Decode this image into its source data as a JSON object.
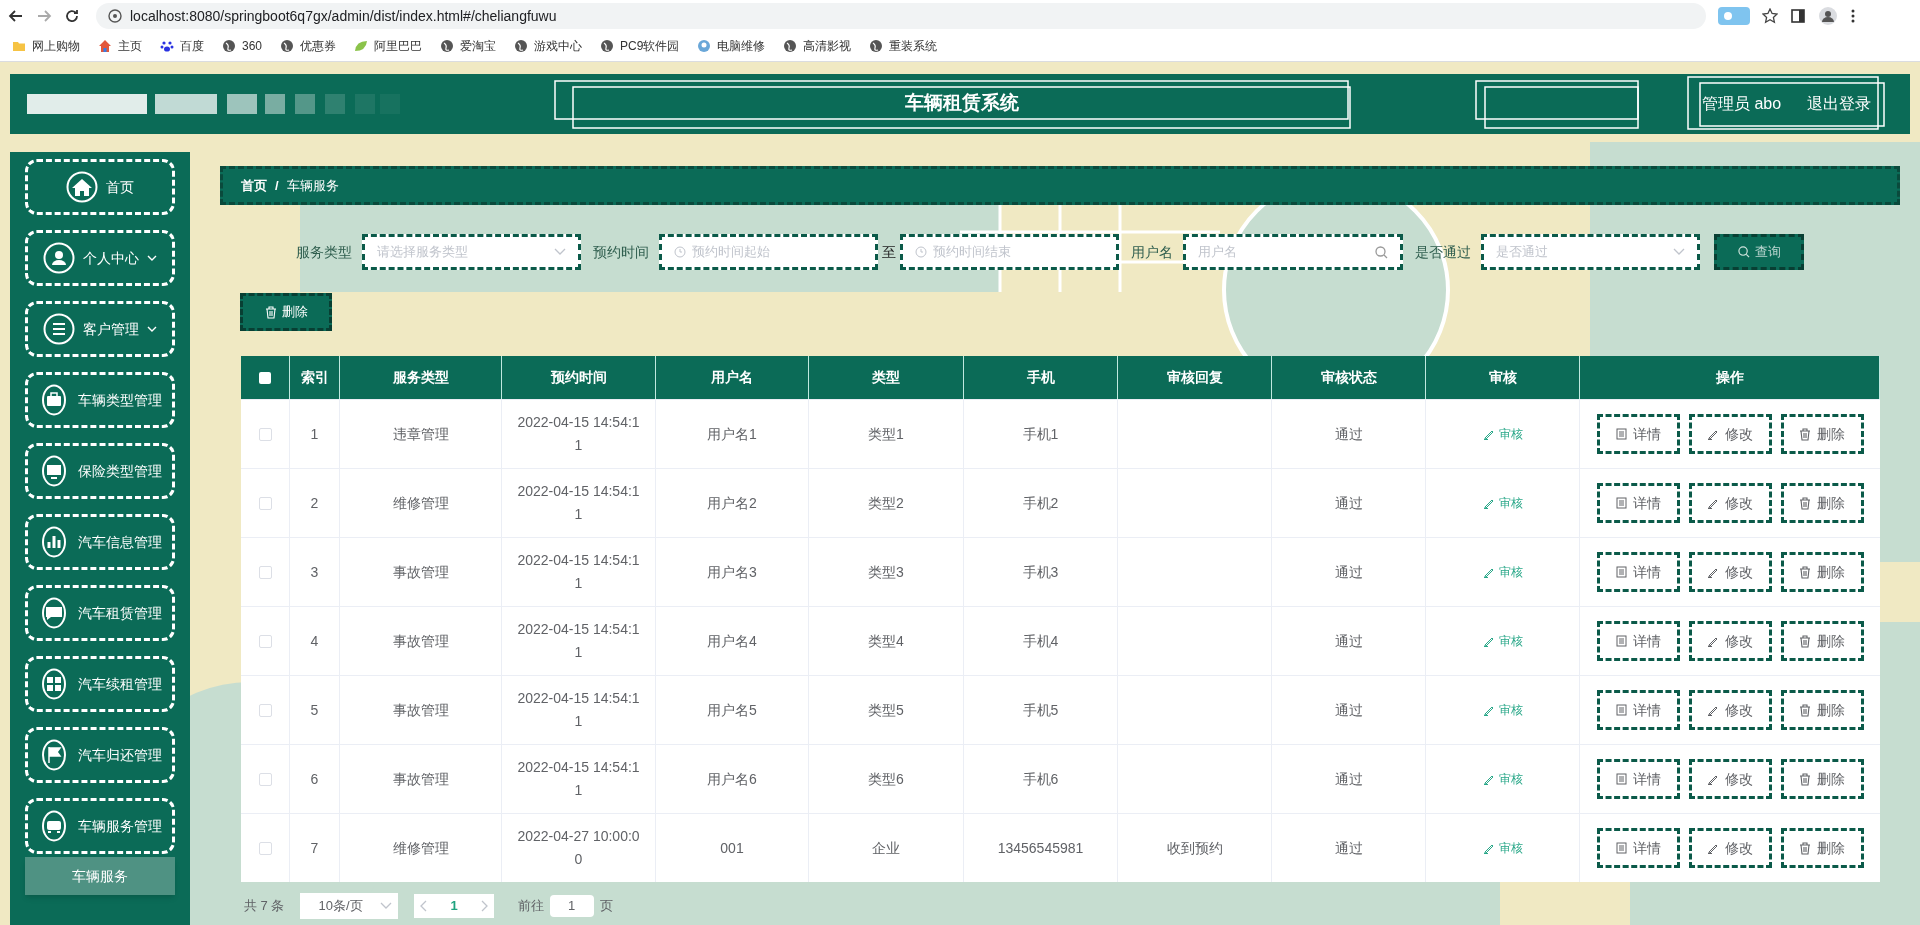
{
  "browser": {
    "url": "localhost:8080/springboot6q7gx/admin/dist/index.html#/cheliangfuwu",
    "bookmarks": [
      {
        "label": "网上购物",
        "kind": "folder"
      },
      {
        "label": "主页",
        "kind": "home"
      },
      {
        "label": "百度",
        "kind": "paw"
      },
      {
        "label": "360",
        "kind": "globe"
      },
      {
        "label": "优惠券",
        "kind": "globe"
      },
      {
        "label": "阿里巴巴",
        "kind": "leaf"
      },
      {
        "label": "爱淘宝",
        "kind": "globe"
      },
      {
        "label": "游戏中心",
        "kind": "globe"
      },
      {
        "label": "PC9软件园",
        "kind": "globe"
      },
      {
        "label": "电脑维修",
        "kind": "badge"
      },
      {
        "label": "高清影视",
        "kind": "globe"
      },
      {
        "label": "重装系统",
        "kind": "globe"
      }
    ]
  },
  "header": {
    "title": "车辆租赁系统",
    "user": "管理员 abo",
    "logout": "退出登录"
  },
  "sidebar": {
    "items": [
      {
        "label": "首页",
        "has_submenu": false
      },
      {
        "label": "个人中心",
        "has_submenu": true
      },
      {
        "label": "客户管理",
        "has_submenu": true
      },
      {
        "label": "车辆类型管理",
        "has_submenu": false
      },
      {
        "label": "保险类型管理",
        "has_submenu": false
      },
      {
        "label": "汽车信息管理",
        "has_submenu": false
      },
      {
        "label": "汽车租赁管理",
        "has_submenu": false
      },
      {
        "label": "汽车续租管理",
        "has_submenu": false
      },
      {
        "label": "汽车归还管理",
        "has_submenu": false
      },
      {
        "label": "车辆服务管理",
        "has_submenu": false,
        "children": [
          {
            "label": "车辆服务",
            "selected": true
          }
        ]
      }
    ]
  },
  "breadcrumb": {
    "items": [
      "首页",
      "车辆服务"
    ],
    "separator": "/"
  },
  "filters": [
    {
      "kind": "select",
      "label": "服务类型",
      "placeholder": "请选择服务类型"
    },
    {
      "kind": "daterange",
      "label": "预约时间",
      "start_placeholder": "预约时间起始",
      "separator": "至",
      "end_placeholder": "预约时间结束"
    },
    {
      "kind": "search",
      "label": "用户名",
      "placeholder": "用户名"
    },
    {
      "kind": "select",
      "label": "是否通过",
      "placeholder": "是否通过"
    }
  ],
  "search_button": "查询",
  "delete_button": "删除",
  "table": {
    "select_all_checked": false,
    "columns": [
      "索引",
      "服务类型",
      "预约时间",
      "用户名",
      "类型",
      "手机",
      "审核回复",
      "审核状态",
      "审核",
      "操作"
    ],
    "rows": [
      {
        "selected": false,
        "index": "1",
        "service_type": "违章管理",
        "time": "2022-04-15 14:54:11",
        "username": "用户名1",
        "type": "类型1",
        "phone": "手机1",
        "status": "通过",
        "audit": "审核",
        "actions": [
          "详情",
          "修改",
          "删除"
        ]
      },
      {
        "selected": false,
        "index": "2",
        "service_type": "维修管理",
        "time": "2022-04-15 14:54:11",
        "username": "用户名2",
        "type": "类型2",
        "phone": "手机2",
        "status": "通过",
        "audit": "审核",
        "actions": [
          "详情",
          "修改",
          "删除"
        ]
      },
      {
        "selected": false,
        "index": "3",
        "service_type": "事故管理",
        "time": "2022-04-15 14:54:11",
        "username": "用户名3",
        "type": "类型3",
        "phone": "手机3",
        "status": "通过",
        "audit": "审核",
        "actions": [
          "详情",
          "修改",
          "删除"
        ]
      },
      {
        "selected": false,
        "index": "4",
        "service_type": "事故管理",
        "time": "2022-04-15 14:54:11",
        "username": "用户名4",
        "type": "类型4",
        "phone": "手机4",
        "status": "通过",
        "audit": "审核",
        "actions": [
          "详情",
          "修改",
          "删除"
        ]
      },
      {
        "selected": false,
        "index": "5",
        "service_type": "事故管理",
        "time": "2022-04-15 14:54:11",
        "username": "用户名5",
        "type": "类型5",
        "phone": "手机5",
        "status": "通过",
        "audit": "审核",
        "actions": [
          "详情",
          "修改",
          "删除"
        ]
      },
      {
        "selected": false,
        "index": "6",
        "service_type": "事故管理",
        "time": "2022-04-15 14:54:11",
        "username": "用户名6",
        "type": "类型6",
        "phone": "手机6",
        "status": "通过",
        "audit": "审核",
        "actions": [
          "详情",
          "修改",
          "删除"
        ]
      },
      {
        "selected": false,
        "index": "7",
        "service_type": "维修管理",
        "time": "2022-04-27 10:00:00",
        "username": "001",
        "type": "企业",
        "phone": "13456545981",
        "reply": "收到预约",
        "status": "通过",
        "audit": "审核",
        "actions": [
          "详情",
          "修改",
          "删除"
        ]
      }
    ]
  },
  "pagination": {
    "total": "共 7 条",
    "page_size": "10条/页",
    "pages": [
      {
        "label": "1",
        "selected": true
      }
    ],
    "goto": "前往",
    "goto_value": "1",
    "suffix": "页"
  }
}
